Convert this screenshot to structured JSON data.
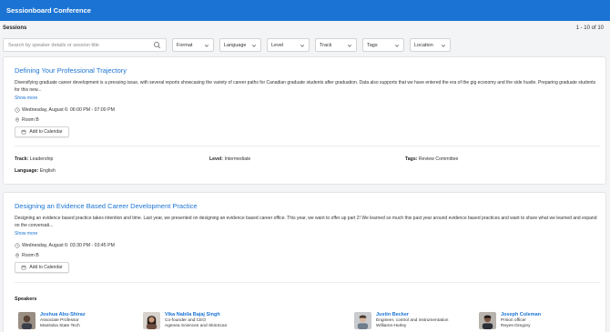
{
  "app": {
    "title": "Sessionboard Conference"
  },
  "subheader": {
    "title": "Sessions",
    "count": "1 - 10 of 10"
  },
  "search": {
    "placeholder": "Search by speaker details or session title"
  },
  "filters": [
    {
      "label": "Format"
    },
    {
      "label": "Language"
    },
    {
      "label": "Level"
    },
    {
      "label": "Track"
    },
    {
      "label": "Tags"
    },
    {
      "label": "Location"
    }
  ],
  "sessions": [
    {
      "title": "Defining Your Professional Trajectory",
      "description": "Diversifying graduate career development is a pressing issue, with several reports showcasing the variety of career paths for Canadian graduate students after graduation. Data also supports that we have entered the era of the gig economy and the side hustle. Preparing graduate students for this new...",
      "show_more": "Show more",
      "datetime": "Wednesday, August 6: 06:00 PM - 07:00 PM",
      "room": "Room B",
      "calendar_label": "Add to Calendar",
      "track_label": "Track:",
      "track": "Leadership",
      "level_label": "Level:",
      "level": "Intermediate",
      "tags_label": "Tags:",
      "tags": "Review Committee",
      "language_label": "Language:",
      "language": "English"
    },
    {
      "title": "Designing an Evidence Based Career Development Practice",
      "description": "Designing an evidence based practice takes intention and time. Last year, we presented on designing an evidence based career office. This year, we want to offer up part 2! We learned so much this past year around evidence based practices and want to share what we learned and expand on the conversati...",
      "show_more": "Show more",
      "datetime": "Wednesday, August 6: 03:30 PM - 03:45 PM",
      "room": "Room B",
      "calendar_label": "Add to Calendar",
      "speakers_heading": "Speakers",
      "speakers": [
        {
          "name": "Joshua Abu-Shiraz",
          "role": "Associate Professor",
          "org": "Manitoba State Tech"
        },
        {
          "name": "Vika Nabila Bajaj Singh",
          "role": "Co-founder and CEO",
          "org": "Agenea Sciences and SkinScan"
        },
        {
          "name": "Justin Becker",
          "role": "Engineer, control and instrumentation",
          "org": "Williams-Hurley"
        },
        {
          "name": "Joseph Coleman",
          "role": "Prison officer",
          "org": "Reyes-Gregory"
        }
      ]
    }
  ],
  "colors": {
    "brand": "#1b74d4",
    "background": "#f3f4f6"
  }
}
